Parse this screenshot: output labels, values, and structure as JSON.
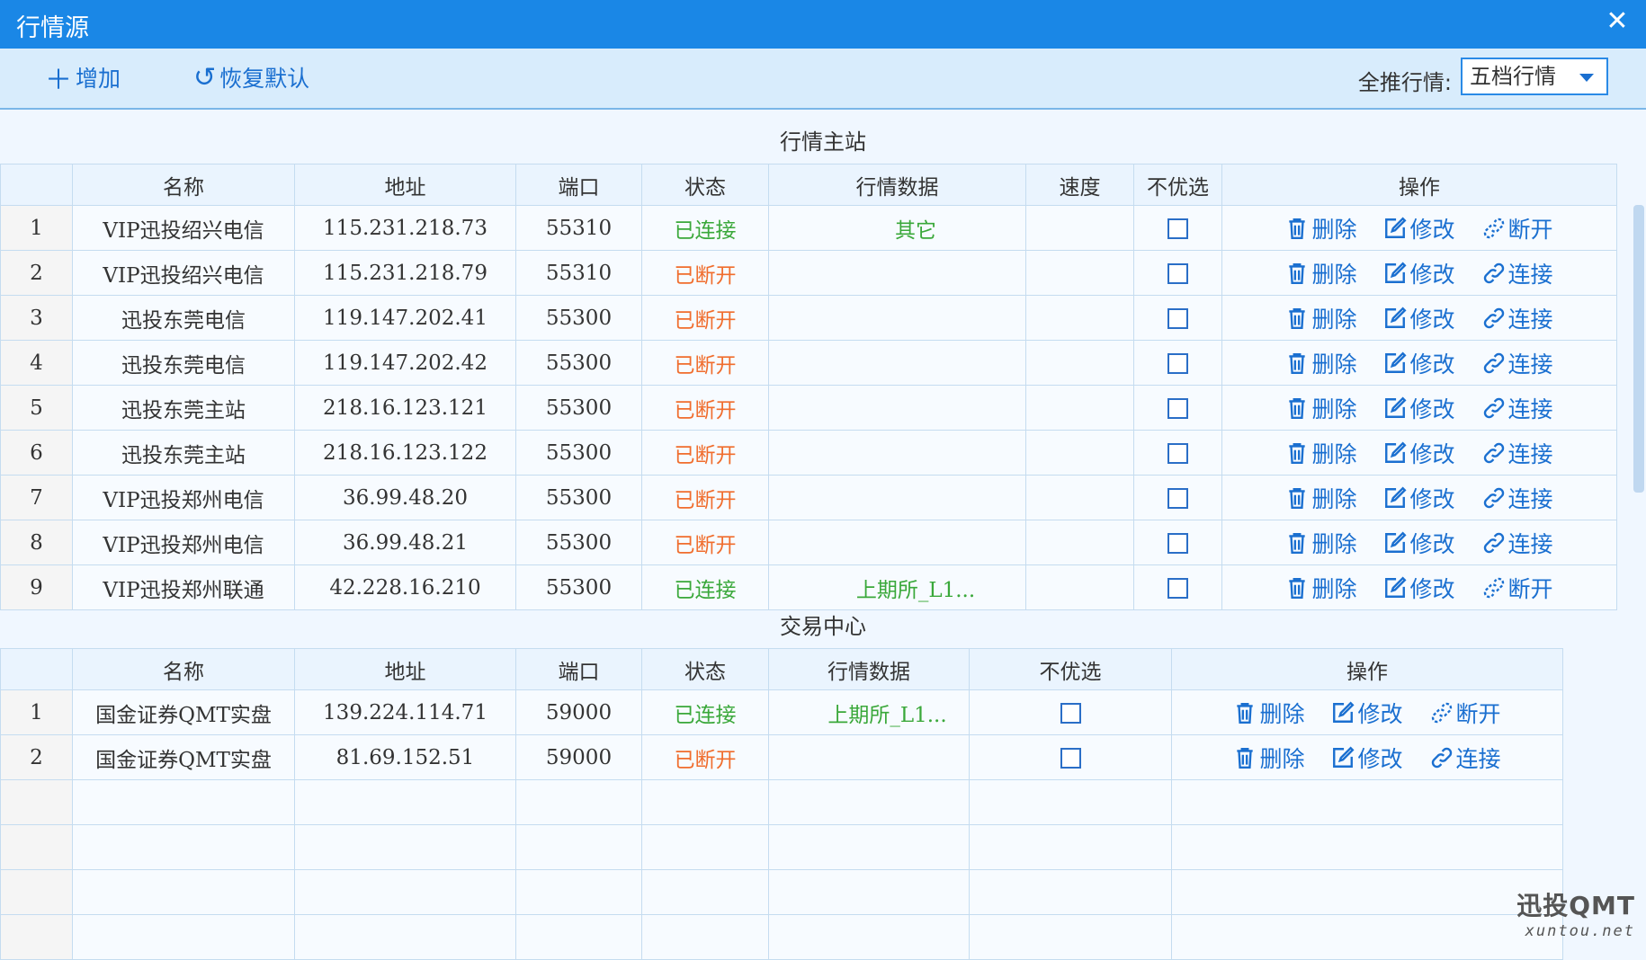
{
  "window": {
    "title": "行情源",
    "close": "✕"
  },
  "toolbar": {
    "add_label": "增加",
    "restore_label": "恢复默认",
    "quote_label": "全推行情:",
    "quote_value": "五档行情"
  },
  "main": {
    "title": "行情主站",
    "headers": [
      "",
      "名称",
      "地址",
      "端口",
      "状态",
      "行情数据",
      "速度",
      "不优选",
      "操作"
    ],
    "rows": [
      {
        "idx": "1",
        "name": "VIP迅投绍兴电信",
        "addr": "115.231.218.73",
        "port": "55310",
        "status": "已连接",
        "quote": "其它",
        "speed": "",
        "op3": "断开"
      },
      {
        "idx": "2",
        "name": "VIP迅投绍兴电信",
        "addr": "115.231.218.79",
        "port": "55310",
        "status": "已断开",
        "quote": "",
        "speed": "",
        "op3": "连接"
      },
      {
        "idx": "3",
        "name": "迅投东莞电信",
        "addr": "119.147.202.41",
        "port": "55300",
        "status": "已断开",
        "quote": "",
        "speed": "",
        "op3": "连接"
      },
      {
        "idx": "4",
        "name": "迅投东莞电信",
        "addr": "119.147.202.42",
        "port": "55300",
        "status": "已断开",
        "quote": "",
        "speed": "",
        "op3": "连接"
      },
      {
        "idx": "5",
        "name": "迅投东莞主站",
        "addr": "218.16.123.121",
        "port": "55300",
        "status": "已断开",
        "quote": "",
        "speed": "",
        "op3": "连接"
      },
      {
        "idx": "6",
        "name": "迅投东莞主站",
        "addr": "218.16.123.122",
        "port": "55300",
        "status": "已断开",
        "quote": "",
        "speed": "",
        "op3": "连接"
      },
      {
        "idx": "7",
        "name": "VIP迅投郑州电信",
        "addr": "36.99.48.20",
        "port": "55300",
        "status": "已断开",
        "quote": "",
        "speed": "",
        "op3": "连接"
      },
      {
        "idx": "8",
        "name": "VIP迅投郑州电信",
        "addr": "36.99.48.21",
        "port": "55300",
        "status": "已断开",
        "quote": "",
        "speed": "",
        "op3": "连接"
      },
      {
        "idx": "9",
        "name": "VIP迅投郑州联通",
        "addr": "42.228.16.210",
        "port": "55300",
        "status": "已连接",
        "quote": "上期所_L1...",
        "speed": "",
        "op3": "断开"
      }
    ]
  },
  "trade": {
    "title": "交易中心",
    "headers": [
      "",
      "名称",
      "地址",
      "端口",
      "状态",
      "行情数据",
      "不优选",
      "操作"
    ],
    "rows": [
      {
        "idx": "1",
        "name": "国金证券QMT实盘",
        "addr": "139.224.114.71",
        "port": "59000",
        "status": "已连接",
        "quote": "上期所_L1...",
        "op3": "断开"
      },
      {
        "idx": "2",
        "name": "国金证券QMT实盘",
        "addr": "81.69.152.51",
        "port": "59000",
        "status": "已断开",
        "quote": "",
        "op3": "连接"
      }
    ],
    "empty_rows": 4
  },
  "ops": {
    "delete": "删除",
    "edit": "修改"
  },
  "colors": {
    "titlebar": "#1a87e6",
    "connected": "#3aa83a",
    "disconnected": "#f06d2d",
    "link": "#1a6fd0"
  },
  "watermark": {
    "big": "迅投QMT",
    "small": "xuntou.net"
  }
}
